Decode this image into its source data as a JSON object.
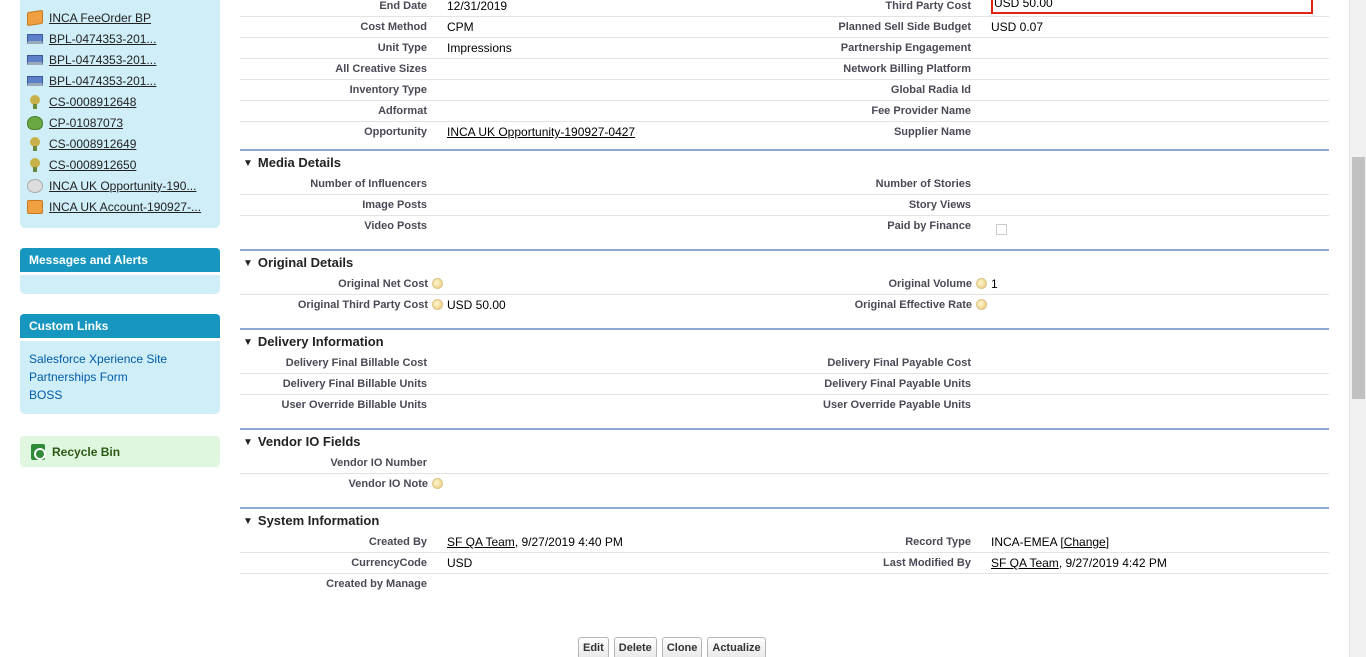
{
  "sidebar": {
    "recent_items": [
      {
        "icon": "order-icon",
        "label": "INCA FeeOrder BP"
      },
      {
        "icon": "computer-icon",
        "label": "BPL-0474353-201..."
      },
      {
        "icon": "computer-icon",
        "label": "BPL-0474353-201..."
      },
      {
        "icon": "computer-icon",
        "label": "BPL-0474353-201..."
      },
      {
        "icon": "lightbulb-icon",
        "label": "CS-0008912648"
      },
      {
        "icon": "money-bag-icon",
        "label": "CP-01087073"
      },
      {
        "icon": "lightbulb-icon",
        "label": "CS-0008912649"
      },
      {
        "icon": "lightbulb-icon",
        "label": "CS-0008912650"
      },
      {
        "icon": "opportunity-icon",
        "label": "INCA UK Opportunity-190..."
      },
      {
        "icon": "account-icon",
        "label": "INCA UK Account-190927-..."
      }
    ],
    "messages_title": "Messages and Alerts",
    "custom_links_title": "Custom Links",
    "custom_links": [
      "Salesforce Xperience Site",
      "Partnerships Form",
      "BOSS"
    ],
    "recycle_bin": "Recycle Bin"
  },
  "detail": {
    "top_rows": [
      {
        "l1": "End Date",
        "v1": "12/31/2019",
        "l2": "Third Party Cost",
        "v2": "USD 50.00"
      },
      {
        "l1": "Cost Method",
        "v1": "CPM",
        "l2": "Planned Sell Side Budget",
        "v2": "USD 0.07"
      },
      {
        "l1": "Unit Type",
        "v1": "Impressions",
        "l2": "Partnership Engagement",
        "v2": ""
      },
      {
        "l1": "All Creative Sizes",
        "v1": "",
        "l2": "Network Billing Platform",
        "v2": ""
      },
      {
        "l1": "Inventory Type",
        "v1": "",
        "l2": "Global Radia Id",
        "v2": ""
      },
      {
        "l1": "Adformat",
        "v1": "",
        "l2": "Fee Provider Name",
        "v2": ""
      },
      {
        "l1": "Opportunity",
        "v1": "INCA UK Opportunity-190927-0427",
        "l2": "Supplier Name",
        "v2": ""
      }
    ],
    "media": {
      "title": "Media Details",
      "rows": [
        {
          "l1": "Number of Influencers",
          "v1": "",
          "l2": "Number of Stories",
          "v2": ""
        },
        {
          "l1": "Image Posts",
          "v1": "",
          "l2": "Story Views",
          "v2": ""
        },
        {
          "l1": "Video Posts",
          "v1": "",
          "l2": "Paid by Finance",
          "v2": ""
        }
      ]
    },
    "original": {
      "title": "Original Details",
      "rows": [
        {
          "l1": "Original Net Cost",
          "v1": "",
          "l2": "Original Volume",
          "v2": "1"
        },
        {
          "l1": "Original Third Party Cost",
          "v1": "USD 50.00",
          "l2": "Original Effective Rate",
          "v2": ""
        }
      ]
    },
    "delivery": {
      "title": "Delivery Information",
      "rows": [
        {
          "l1": "Delivery Final Billable Cost",
          "v1": "",
          "l2": "Delivery Final Payable Cost",
          "v2": ""
        },
        {
          "l1": "Delivery Final Billable Units",
          "v1": "",
          "l2": "Delivery Final Payable Units",
          "v2": ""
        },
        {
          "l1": "User Override Billable Units",
          "v1": "",
          "l2": "User Override Payable Units",
          "v2": ""
        }
      ]
    },
    "vendor": {
      "title": "Vendor IO Fields",
      "rows": [
        {
          "l1": "Vendor IO Number",
          "v1": ""
        },
        {
          "l1": "Vendor IO Note",
          "v1": ""
        }
      ]
    },
    "system": {
      "title": "System Information",
      "created_by_label": "Created By",
      "created_by_user": "SF QA Team",
      "created_by_date": ", 9/27/2019 4:40 PM",
      "record_type_label": "Record Type",
      "record_type_value": "INCA-EMEA",
      "record_type_change_open": " [",
      "record_type_change": "Change",
      "record_type_change_close": "]",
      "currency_label": "CurrencyCode",
      "currency_value": "USD",
      "last_modified_label": "Last Modified By",
      "last_modified_user": "SF QA Team",
      "last_modified_date": ", 9/27/2019 4:42 PM",
      "created_by_manage_label": "Created by Manage"
    }
  },
  "buttons": {
    "edit": "Edit",
    "delete": "Delete",
    "clone": "Clone",
    "actualize": "Actualize"
  }
}
